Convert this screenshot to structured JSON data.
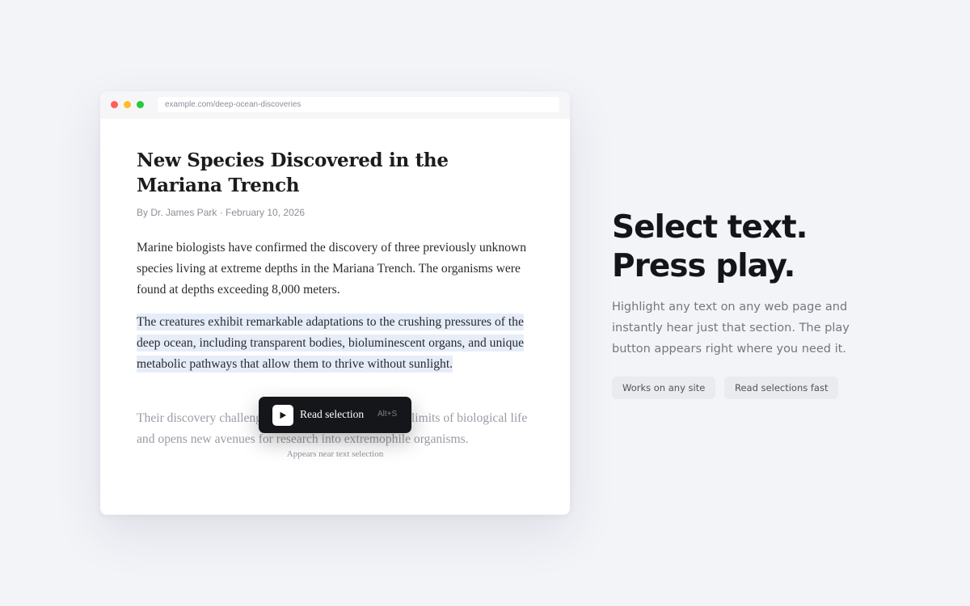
{
  "browser": {
    "url": "example.com/deep-ocean-discoveries"
  },
  "article": {
    "title": "New Species Discovered in the Mariana Trench",
    "byline": "By Dr. James Park · February 10, 2026",
    "paragraphs": [
      "Marine biologists have confirmed the discovery of three previously unknown species living at extreme depths in the Mariana Trench. The organisms were found at depths exceeding 8,000 meters.",
      "The creatures exhibit remarkable adaptations to the crushing pressures of the deep ocean, including transparent bodies, bioluminescent organs, and unique metabolic pathways that allow them to thrive without sunlight.",
      "Their discovery challenges existing theories about the limits of biological life and opens new avenues for research into extremophile organisms."
    ]
  },
  "popup": {
    "label": "Read selection",
    "shortcut": "Alt+S",
    "caption": "Appears near text selection",
    "play_icon": "play-icon"
  },
  "marketing": {
    "headline_line1": "Select text.",
    "headline_line2": "Press play.",
    "description": "Highlight any text on any web page and instantly hear just that section. The play button appears right where you need it.",
    "pills": [
      "Works on any site",
      "Read selections fast"
    ]
  },
  "colors": {
    "background": "#f3f4f8",
    "highlight": "#e6edf8",
    "popup": "#15161a",
    "dot_red": "#ff5f57",
    "dot_yellow": "#febc2e",
    "dot_green": "#28c840"
  }
}
